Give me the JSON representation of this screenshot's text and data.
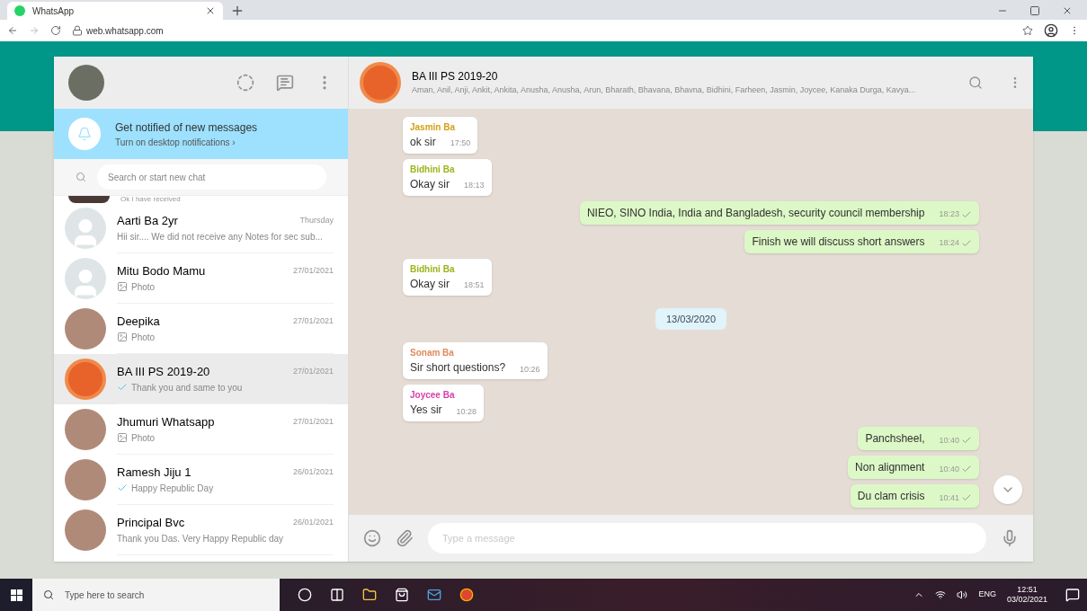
{
  "browser": {
    "tab_title": "WhatsApp",
    "url": "web.whatsapp.com"
  },
  "notification": {
    "title": "Get notified of new messages",
    "link": "Turn on desktop notifications ›"
  },
  "search": {
    "placeholder": "Search or start new chat"
  },
  "partial_chat": {
    "preview": "Ok I have received"
  },
  "chats": [
    {
      "name": "Aarti Ba 2yr",
      "preview": "Hii sir.... We did not receive any Notes for sec sub...",
      "time": "Thursday",
      "kind": "default",
      "selected": false,
      "tick": false,
      "photo": false
    },
    {
      "name": "Mitu Bodo Mamu",
      "preview": "Photo",
      "time": "27/01/2021",
      "kind": "default",
      "selected": false,
      "tick": false,
      "photo": true
    },
    {
      "name": "Deepika",
      "preview": "Photo",
      "time": "27/01/2021",
      "kind": "photo",
      "selected": false,
      "tick": false,
      "photo": true
    },
    {
      "name": "BA III PS 2019-20",
      "preview": "Thank you and same to you",
      "time": "27/01/2021",
      "kind": "group",
      "selected": true,
      "tick": true,
      "photo": false
    },
    {
      "name": "Jhumuri Whatsapp",
      "preview": "Photo",
      "time": "27/01/2021",
      "kind": "photo",
      "selected": false,
      "tick": false,
      "photo": true
    },
    {
      "name": "Ramesh Jiju 1",
      "preview": "Happy Republic Day",
      "time": "26/01/2021",
      "kind": "photo",
      "selected": false,
      "tick": true,
      "photo": false
    },
    {
      "name": "Principal Bvc",
      "preview": "Thank you Das. Very Happy Republic day",
      "time": "26/01/2021",
      "kind": "photo",
      "selected": false,
      "tick": false,
      "photo": false
    }
  ],
  "conversation": {
    "title": "BA III PS 2019-20",
    "members": "Aman, Anil, Anji, Ankit, Ankita, Anusha, Anusha, Arun, Bharath, Bhavana, Bhavna, Bidhini, Farheen, Jasmin, Joycee, Kanaka Durga, Kavya...",
    "messages": [
      {
        "kind": "in",
        "sender": "Jasmin Ba",
        "color": "#d4a017",
        "text": "ok sir",
        "time": "17:50"
      },
      {
        "kind": "in",
        "sender": "Bidhini Ba",
        "color": "#9ab51a",
        "text": "Okay sir",
        "time": "18:13"
      },
      {
        "kind": "out",
        "text": "NIEO, SINO India, India and Bangladesh,  security council membership",
        "time": "18:23",
        "tick": true
      },
      {
        "kind": "out",
        "text": "Finish we will discuss short answers",
        "time": "18:24",
        "tick": true
      },
      {
        "kind": "in",
        "sender": "Bidhini Ba",
        "color": "#9ab51a",
        "text": "Okay sir",
        "time": "18:51"
      },
      {
        "kind": "date",
        "text": "13/03/2020"
      },
      {
        "kind": "in",
        "sender": "Sonam Ba",
        "color": "#e08a5c",
        "text": "Sir short questions?",
        "time": "10:26"
      },
      {
        "kind": "in",
        "sender": "Joycee Ba",
        "color": "#d63fa8",
        "text": "Yes sir",
        "time": "10:28"
      },
      {
        "kind": "out",
        "text": "Panchsheel,",
        "time": "10:40",
        "tick": true
      },
      {
        "kind": "out",
        "text": "Non alignment",
        "time": "10:40",
        "tick": true
      },
      {
        "kind": "out",
        "text": "Du clam crisis",
        "time": "10:41",
        "tick": true
      }
    ],
    "composer": {
      "placeholder": "Type a message"
    }
  },
  "taskbar": {
    "search_placeholder": "Type here to search",
    "language": "ENG",
    "time": "12:51",
    "date": "03/02/2021"
  }
}
